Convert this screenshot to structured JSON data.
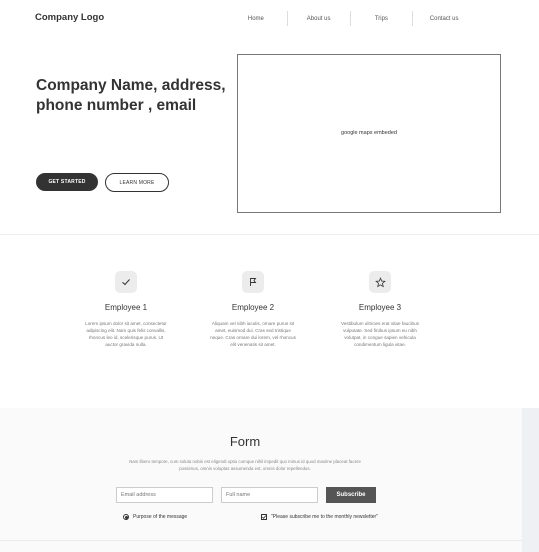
{
  "header": {
    "logo": "Company Logo",
    "nav": [
      "Home",
      "About us",
      "Trips",
      "Contact us"
    ]
  },
  "hero": {
    "title": "Company Name, address, phone number , email",
    "primary_button": "GET STARTED",
    "secondary_button": "LEARN MORE",
    "map_placeholder": "google maps embeded"
  },
  "features": [
    {
      "icon": "check-icon",
      "title": "Employee 1",
      "text": "Lorem ipsum dolor sit amet, consectetur adipiscing elit. Nam quis felis convallis, rhoncus leo id, scelerisque purus. Ut auctor gravida nulla."
    },
    {
      "icon": "flag-icon",
      "title": "Employee 2",
      "text": "Aliquam vel nibh iaculis, ornare purus sit amet, euismod dui. Cras sed tristique neque. Cras ornare dui lorem, vel rhoncus elit venenatis sit amet."
    },
    {
      "icon": "star-icon",
      "title": "Employee 3",
      "text": "Vestibulum ultricies erat vitae faucibus vulputate. Sed finibus ipsum eu nibh volutpat, in congue sapien vehicula condimentum ligula vitae."
    }
  ],
  "form": {
    "title": "Form",
    "description": "Nam libero tempore, cum soluta nobis est eligendi optio cumque nihil impedit quo minus id quod maxime placeat facere possimus, omnis voluptas assumenda est, omnis dolor repellendus.",
    "email_placeholder": "Email address",
    "name_placeholder": "Full name",
    "subscribe_label": "Subscribe",
    "radio_label": "Purpose of the message",
    "checkbox_label": "\"Please subscribe me to the monthly newsletter\""
  }
}
